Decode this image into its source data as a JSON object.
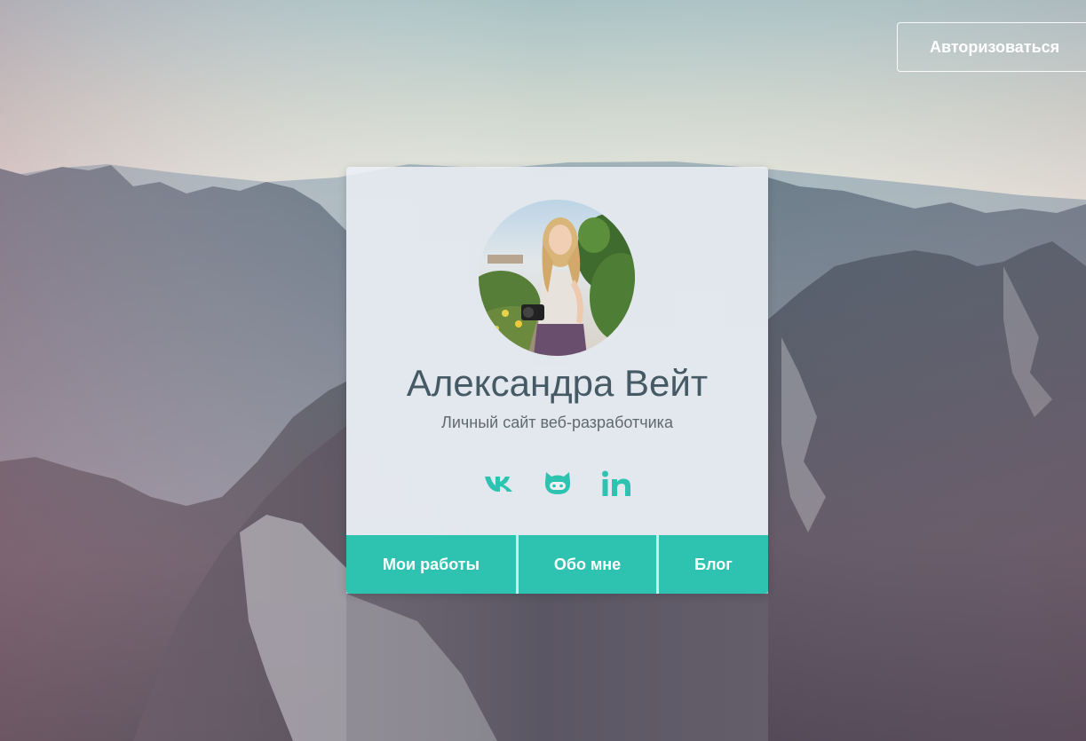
{
  "header": {
    "auth_label": "Авторизоваться"
  },
  "profile": {
    "name": "Александра Вейт",
    "subtitle": "Личный сайт веб-разработчика",
    "avatar_icon": "user-photo-avatar"
  },
  "socials": [
    {
      "icon": "vk-icon"
    },
    {
      "icon": "github-icon"
    },
    {
      "icon": "linkedin-icon"
    }
  ],
  "nav": {
    "works": "Мои работы",
    "about": "Обо мне",
    "blog": "Блог"
  },
  "colors": {
    "accent": "#2dc3b0",
    "title": "#455a64",
    "subtitle": "#5f6a70"
  }
}
